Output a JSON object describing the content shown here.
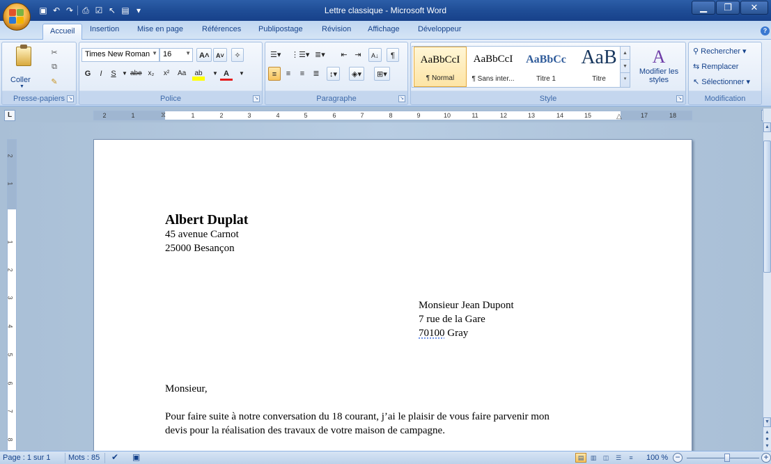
{
  "window": {
    "title": "Lettre classique - Microsoft Word",
    "minimize": "▁",
    "restore": "❐",
    "close": "✕"
  },
  "quick_access": [
    "save-icon",
    "undo-icon",
    "redo-icon",
    "print-preview-icon",
    "spelling-icon",
    "pointer-icon",
    "new-icon"
  ],
  "tabs": [
    {
      "label": "Accueil",
      "active": true
    },
    {
      "label": "Insertion"
    },
    {
      "label": "Mise en page"
    },
    {
      "label": "Références"
    },
    {
      "label": "Publipostage"
    },
    {
      "label": "Révision"
    },
    {
      "label": "Affichage"
    },
    {
      "label": "Développeur"
    }
  ],
  "ribbon": {
    "clipboard": {
      "label": "Presse-papiers",
      "paste": "Coller"
    },
    "font": {
      "label": "Police",
      "font_name": "Times New Roman",
      "font_size": "16",
      "bold": "G",
      "italic": "I",
      "underline": "S",
      "strike": "abe",
      "subscript": "x₂",
      "superscript": "x²",
      "change_case": "Aa",
      "grow": "A˄",
      "shrink": "A˅",
      "highlight": "ab",
      "font_color": "A"
    },
    "paragraph": {
      "label": "Paragraphe"
    },
    "styles": {
      "label": "Style",
      "items": [
        {
          "preview": "AaBbCcI",
          "name": "¶ Normal",
          "selected": true
        },
        {
          "preview": "AaBbCcI",
          "name": "¶ Sans inter..."
        },
        {
          "preview": "AaBbCc",
          "name": "Titre 1"
        },
        {
          "preview": "AaB",
          "name": "Titre"
        }
      ],
      "modify": "Modifier les styles"
    },
    "editing": {
      "label": "Modification",
      "find": "Rechercher",
      "replace": "Remplacer",
      "select": "Sélectionner"
    }
  },
  "ruler": {
    "labels": [
      "2",
      "1",
      "1",
      "2",
      "3",
      "4",
      "5",
      "6",
      "7",
      "8",
      "9",
      "10",
      "11",
      "12",
      "13",
      "14",
      "15",
      "17",
      "18"
    ],
    "vertical_labels": [
      "2",
      "1",
      "1",
      "2",
      "3",
      "4",
      "5",
      "6",
      "7",
      "8"
    ]
  },
  "document": {
    "sender": {
      "name": "Albert Duplat",
      "street": "45 avenue Carnot",
      "city": "25000 Besançon"
    },
    "recipient": {
      "name": "Monsieur Jean Dupont",
      "street": "7 rue de la Gare",
      "postcode": "70100",
      "city": " Gray"
    },
    "salutation": "Monsieur,",
    "body_line1": "Pour faire suite à notre conversation du 18 courant, j’ai le plaisir de vous faire parvenir mon",
    "body_line2": "devis pour la réalisation des travaux de votre maison de campagne."
  },
  "status": {
    "page": "Page : 1 sur 1",
    "words": "Mots : 85",
    "zoom": "100 %"
  },
  "colors": {
    "title_bar": "#1f4d96",
    "ribbon": "#dce7f5",
    "workspace": "#a9bfd6",
    "accent_selected": "#f8c45c"
  }
}
